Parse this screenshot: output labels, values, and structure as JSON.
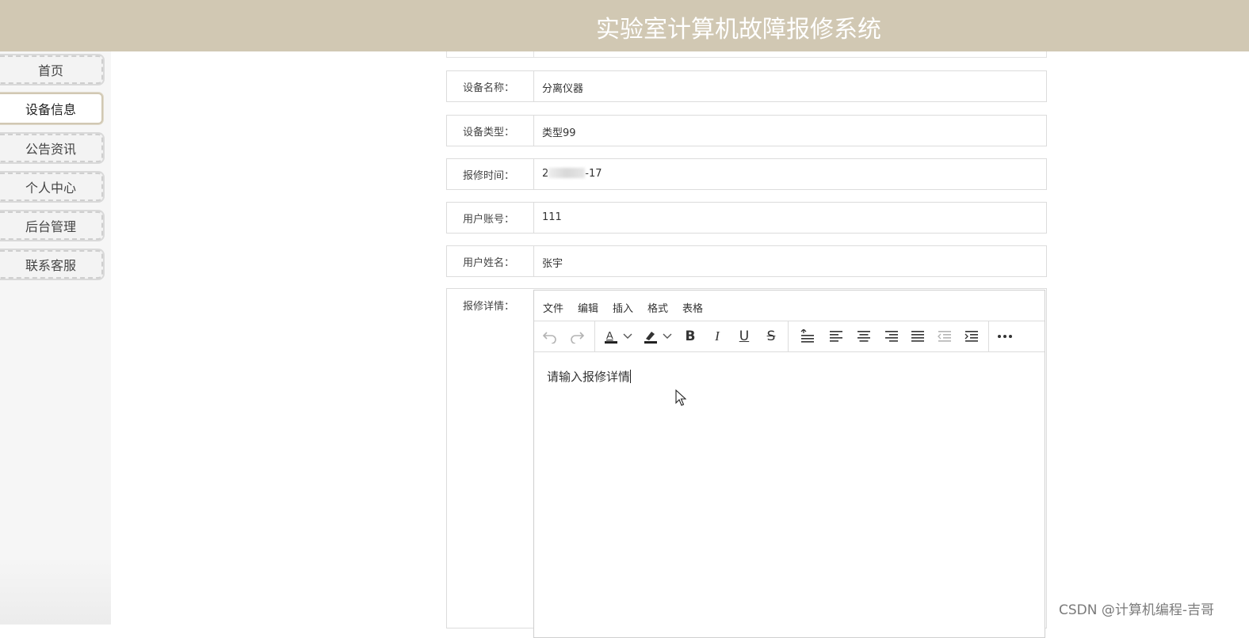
{
  "header": {
    "title": "实验室计算机故障报修系统"
  },
  "nav": {
    "items": [
      {
        "label": "首页"
      },
      {
        "label": "设备信息"
      },
      {
        "label": "公告资讯"
      },
      {
        "label": "个人中心"
      },
      {
        "label": "后台管理"
      },
      {
        "label": "联系客服"
      }
    ],
    "active_index": 1
  },
  "form": {
    "rows": [
      {
        "label": "设备名称：",
        "value": "分离仪器"
      },
      {
        "label": "设备类型：",
        "value": "类型99"
      },
      {
        "label": "报修时间：",
        "value_prefix": "2",
        "value_suffix": "-17"
      },
      {
        "label": "用户账号：",
        "value": "111"
      },
      {
        "label": "用户姓名：",
        "value": "张宇"
      }
    ],
    "detail": {
      "label": "报修详情：",
      "menu": [
        "文件",
        "编辑",
        "插入",
        "格式",
        "表格"
      ],
      "toolbar_icons": [
        "undo-icon",
        "redo-icon",
        "text-color-icon",
        "highlight-color-icon",
        "bold-icon",
        "italic-icon",
        "underline-icon",
        "strikethrough-icon",
        "line-height-icon",
        "align-left-icon",
        "align-center-icon",
        "align-right-icon",
        "align-justify-icon",
        "outdent-icon",
        "indent-icon",
        "more-icon"
      ],
      "content": "请输入报修详情"
    }
  },
  "watermark": "CSDN @计算机编程-吉哥",
  "colors": {
    "header_bg": "#d1c8b3",
    "header_text": "#ffffff"
  }
}
